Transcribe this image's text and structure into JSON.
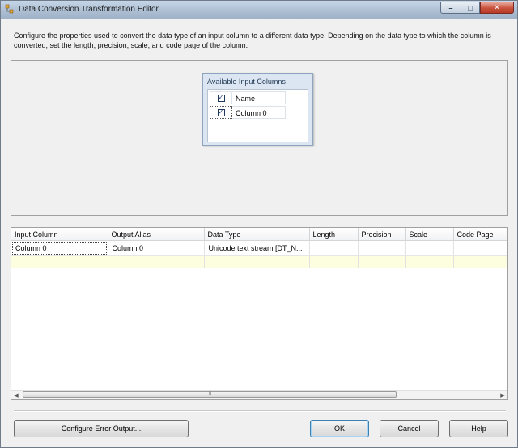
{
  "window": {
    "title": "Data Conversion Transformation Editor",
    "minimize_glyph": "–",
    "maximize_glyph": "□",
    "close_glyph": "✕"
  },
  "description": "Configure the properties used to convert the data type of an input column to a different data type. Depending on the data type to which the column is converted, set the length, precision, scale, and code page of the column.",
  "available_columns": {
    "title": "Available Input Columns",
    "header": {
      "name": "Name",
      "checked": true
    },
    "items": [
      {
        "name": "Column 0",
        "checked": true
      }
    ]
  },
  "grid": {
    "headers": [
      "Input Column",
      "Output Alias",
      "Data Type",
      "Length",
      "Precision",
      "Scale",
      "Code Page"
    ],
    "rows": [
      [
        "Column 0",
        "Column 0",
        "Unicode text stream [DT_N...",
        "",
        "",
        "",
        ""
      ]
    ],
    "scroll_grip": "III"
  },
  "buttons": {
    "configure_error": "Configure Error Output...",
    "ok": "OK",
    "cancel": "Cancel",
    "help": "Help"
  },
  "colors": {
    "titlebar": "#aebfd3",
    "close_button": "#c8513c",
    "new_row": "#fdfde0",
    "panel_bg": "#dce6f2"
  },
  "icons": {
    "check": "✓",
    "scroll_left": "◀",
    "scroll_right": "▶"
  }
}
